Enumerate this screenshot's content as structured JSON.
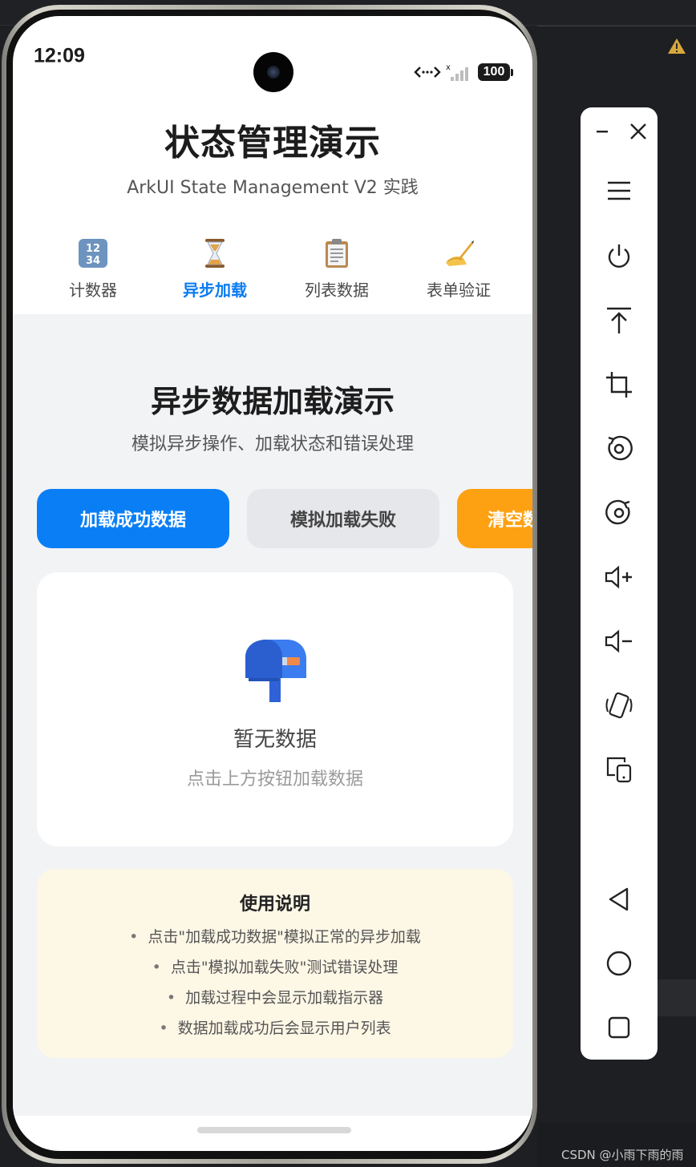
{
  "status_bar": {
    "time": "12:09",
    "battery": "100",
    "icons": [
      "data-transfer-icon",
      "signal-icon"
    ]
  },
  "header": {
    "title": "状态管理演示",
    "subtitle": "ArkUI State Management V2 实践"
  },
  "tabs": [
    {
      "label": "计数器",
      "icon": "numbers-icon",
      "active": false
    },
    {
      "label": "异步加载",
      "icon": "hourglass-icon",
      "active": true
    },
    {
      "label": "列表数据",
      "icon": "clipboard-icon",
      "active": false
    },
    {
      "label": "表单验证",
      "icon": "writing-hand-icon",
      "active": false
    }
  ],
  "demo": {
    "title": "异步数据加载演示",
    "subtitle": "模拟异步操作、加载状态和错误处理",
    "buttons": {
      "success": "加载成功数据",
      "fail": "模拟加载失败",
      "clear": "清空数"
    },
    "empty_state": {
      "icon": "mailbox-icon",
      "title": "暂无数据",
      "hint": "点击上方按钮加载数据"
    },
    "instructions": {
      "title": "使用说明",
      "items": [
        "点击\"加载成功数据\"模拟正常的异步加载",
        "点击\"模拟加载失败\"测试错误处理",
        "加载过程中会显示加载指示器",
        "数据加载成功后会显示用户列表"
      ]
    }
  },
  "colors": {
    "accent": "#0a7ff5",
    "warning": "#fda112",
    "notes_bg": "#fdf7e6",
    "content_bg": "#f2f3f5"
  },
  "emulator_toolbar": {
    "items": [
      "minimize-icon",
      "close-icon",
      "menu-icon",
      "power-icon",
      "pin-top-icon",
      "crop-icon",
      "rotate-left-icon",
      "rotate-right-icon",
      "volume-up-icon",
      "volume-down-icon",
      "shake-icon",
      "multi-device-icon",
      "back-icon",
      "home-icon",
      "recents-icon"
    ]
  },
  "watermark": "CSDN @小雨下雨的雨"
}
